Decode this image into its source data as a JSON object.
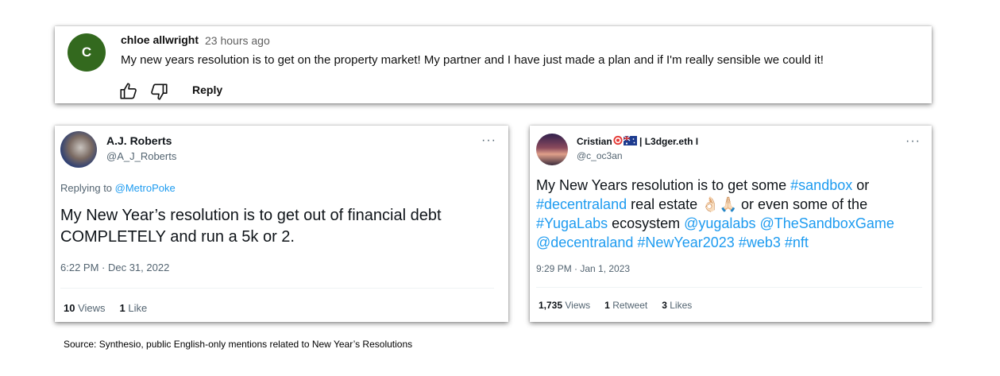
{
  "youtube_comment": {
    "avatar_letter": "C",
    "author": "chloe allwright",
    "time": "23 hours ago",
    "text": "My new years resolution is to get on the property market! My partner and I have just made a plan and if I'm really sensible we could it!",
    "reply_label": "Reply",
    "colors": {
      "avatar": "#33691e"
    }
  },
  "tweet1": {
    "name": "A.J. Roberts",
    "handle": "@A_J_Roberts",
    "replying_prefix": "Replying to ",
    "replying_to": "@MetroPoke",
    "body_line1": "My New Year’s resolution is to get out of financial debt",
    "body_line2": "COMPLETELY and run a 5k or 2.",
    "timestamp": "6:22 PM · Dec 31, 2022",
    "views_count": "10",
    "views_label": " Views",
    "likes_count": "1",
    "likes_label": " Like"
  },
  "tweet2": {
    "name_prefix": "Cristian",
    "name_suffix": " | L3dger.eth I",
    "handle": "@c_oc3an",
    "body": {
      "t1": "My New Years resolution is to get some ",
      "sandbox": "#sandbox",
      "t2": " or",
      "decentraland": "#decentraland",
      "t3": " real estate ",
      "emojis": "👌🏻🙏🏻",
      "t4": " or even some of the",
      "yugalabs_tag": "#YugaLabs",
      "t5": " ecosystem ",
      "yugalabs_mention": "@yugalabs",
      "sandboxgame": "@TheSandboxGame",
      "decentraland_mention": "@decentraland",
      "newyear": "#NewYear2023",
      "web3": "#web3",
      "nft": "#nft"
    },
    "timestamp": "9:29 PM · Jan 1, 2023",
    "views_count": "1,735",
    "views_label": " Views",
    "retweets_count": "1",
    "retweets_label": " Retweet",
    "likes_count": "3",
    "likes_label": " Likes",
    "colors": {
      "link": "#1d9bf0"
    }
  },
  "more_label": "···",
  "source": "Source: Synthesio, public English-only mentions related to New Year’s Resolutions"
}
